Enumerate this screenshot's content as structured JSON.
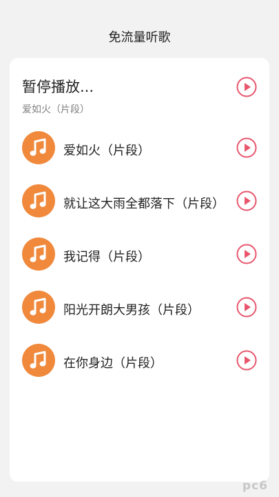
{
  "header": {
    "title": "免流量听歌"
  },
  "now_playing": {
    "status": "暂停播放...",
    "song": "爱如火（片段）",
    "action_icon": "play-circle-icon"
  },
  "songs": [
    {
      "title": "爱如火（片段）"
    },
    {
      "title": "就让这大雨全都落下（片段）"
    },
    {
      "title": "我记得（片段）"
    },
    {
      "title": "阳光开朗大男孩（片段）"
    },
    {
      "title": "在你身边（片段）"
    }
  ],
  "watermark": "pc6",
  "colors": {
    "accent_play": "#e8566d",
    "music_icon_bg": "#f0893c",
    "page_bg": "#f2f2f2",
    "card_bg": "#ffffff"
  }
}
